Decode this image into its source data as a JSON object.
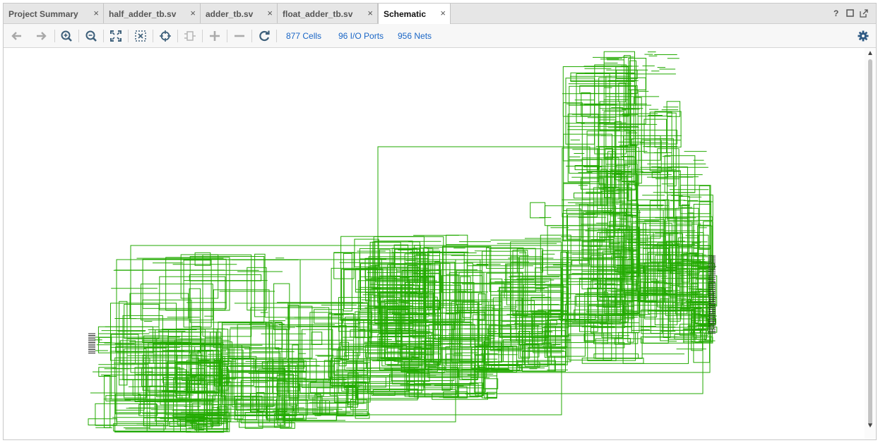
{
  "tabs": [
    {
      "label": "Project Summary",
      "active": false
    },
    {
      "label": "half_adder_tb.sv",
      "active": false
    },
    {
      "label": "adder_tb.sv",
      "active": false
    },
    {
      "label": "float_adder_tb.sv",
      "active": false
    },
    {
      "label": "Schematic",
      "active": true
    }
  ],
  "tab_close_glyph": "×",
  "window_controls": {
    "help": "?",
    "maximize_icon": "maximize-icon",
    "float_icon": "float-icon"
  },
  "toolbar": {
    "icons": [
      "back-arrow-icon",
      "forward-arrow-icon",
      "zoom-in-icon",
      "zoom-out-icon",
      "zoom-fit-icon",
      "zoom-area-icon",
      "select-target-icon",
      "cell-icon",
      "expand-plus-icon",
      "collapse-minus-icon",
      "refresh-icon"
    ],
    "stats": {
      "cells": "877 Cells",
      "ports": "96 I/O Ports",
      "nets": "956 Nets"
    },
    "settings_icon": "gear-icon"
  },
  "schematic": {
    "wire_color": "#22aa00",
    "background": "#ffffff"
  },
  "colors": {
    "accent_link": "#1a66c6",
    "tab_bar": "#e6e6e6",
    "toolbar": "#f7f7f7"
  }
}
